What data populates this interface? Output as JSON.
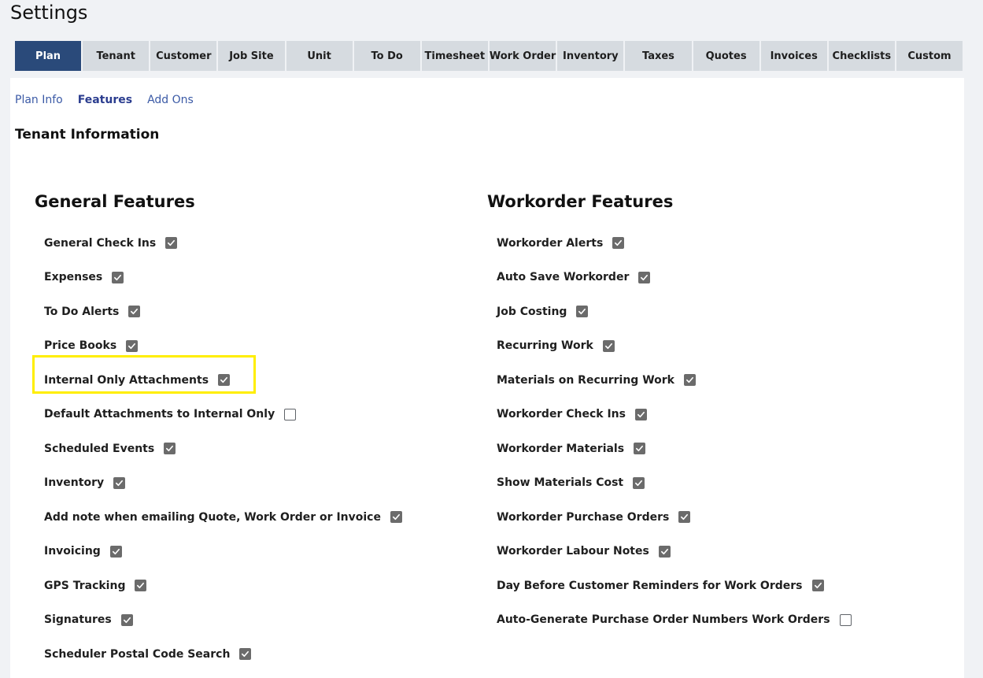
{
  "page": {
    "title": "Settings"
  },
  "tabs": [
    {
      "label": "Plan",
      "active": true
    },
    {
      "label": "Tenant",
      "active": false
    },
    {
      "label": "Customer",
      "active": false
    },
    {
      "label": "Job Site",
      "active": false
    },
    {
      "label": "Unit",
      "active": false
    },
    {
      "label": "To Do",
      "active": false
    },
    {
      "label": "Timesheet",
      "active": false
    },
    {
      "label": "Work Order",
      "active": false
    },
    {
      "label": "Inventory",
      "active": false
    },
    {
      "label": "Taxes",
      "active": false
    },
    {
      "label": "Quotes",
      "active": false
    },
    {
      "label": "Invoices",
      "active": false
    },
    {
      "label": "Checklists",
      "active": false
    },
    {
      "label": "Custom",
      "active": false
    }
  ],
  "subtabs": [
    {
      "label": "Plan Info",
      "active": false
    },
    {
      "label": "Features",
      "active": true
    },
    {
      "label": "Add Ons",
      "active": false
    }
  ],
  "section_title": "Tenant Information",
  "general": {
    "heading": "General Features",
    "features": [
      {
        "label": "General Check Ins",
        "checked": true
      },
      {
        "label": "Expenses",
        "checked": true
      },
      {
        "label": "To Do Alerts",
        "checked": true
      },
      {
        "label": "Price Books",
        "checked": true
      },
      {
        "label": "Internal Only Attachments",
        "checked": true,
        "highlighted": true
      },
      {
        "label": "Default Attachments to Internal Only",
        "checked": false
      },
      {
        "label": "Scheduled Events",
        "checked": true
      },
      {
        "label": "Inventory",
        "checked": true
      },
      {
        "label": "Add note when emailing Quote, Work Order or Invoice",
        "checked": true
      },
      {
        "label": "Invoicing",
        "checked": true
      },
      {
        "label": "GPS Tracking",
        "checked": true
      },
      {
        "label": "Signatures",
        "checked": true
      },
      {
        "label": "Scheduler Postal Code Search",
        "checked": true
      }
    ]
  },
  "workorder": {
    "heading": "Workorder Features",
    "features": [
      {
        "label": "Workorder Alerts",
        "checked": true
      },
      {
        "label": "Auto Save Workorder",
        "checked": true
      },
      {
        "label": "Job Costing",
        "checked": true
      },
      {
        "label": "Recurring Work",
        "checked": true
      },
      {
        "label": "Materials on Recurring Work",
        "checked": true
      },
      {
        "label": "Workorder Check Ins",
        "checked": true
      },
      {
        "label": "Workorder Materials",
        "checked": true
      },
      {
        "label": "Show Materials Cost",
        "checked": true
      },
      {
        "label": "Workorder Purchase Orders",
        "checked": true
      },
      {
        "label": "Workorder Labour Notes",
        "checked": true
      },
      {
        "label": "Day Before Customer Reminders for Work Orders",
        "checked": true
      },
      {
        "label": "Auto-Generate Purchase Order Numbers Work Orders",
        "checked": false
      }
    ]
  },
  "colors": {
    "active_tab": "#2a4a7a",
    "inactive_tab": "#d6dbe0",
    "highlight": "#ffee00",
    "link": "#3b5aa6",
    "checkbox_checked": "#6b6b6b"
  }
}
